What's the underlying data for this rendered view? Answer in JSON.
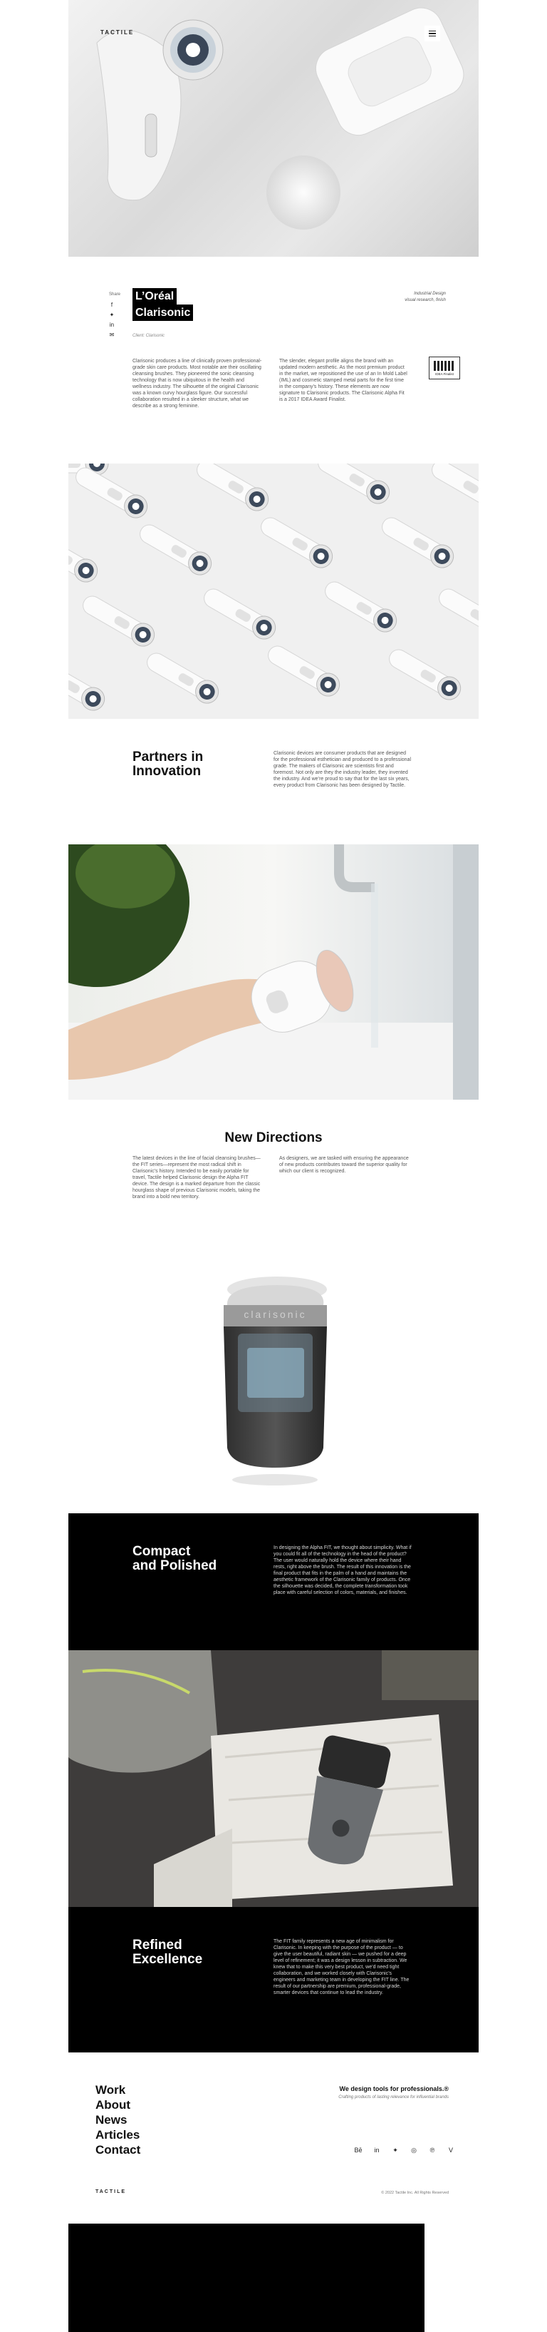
{
  "header": {
    "logo": "TACTILE"
  },
  "intro": {
    "share_label": "Share",
    "title_line1": "L’Oréal",
    "title_line2": "Clarisonic",
    "client_label": "Client: Clarisonic",
    "services": "Industrial Design\nvisual research, finish",
    "para_left": "Clarisonic produces a line of clinically proven professional-grade skin care products. Most notable are their oscillating cleansing brushes. They pioneered the sonic cleansing technology that is now ubiquitous in the health and wellness industry. The silhouette of the original Clarisonic was a known curvy hourglass figure. Our successful collaboration resulted in a sleeker structure, what we describe as a strong feminine.",
    "para_right": "The slender, elegant profile aligns the brand with an updated modern aesthetic. As the most premium product in the market, we repositioned the use of an In Mold Label (IML) and cosmetic stamped metal parts for the first time in the company’s history. These elements are now signature to Clarisonic products. The Clarisonic Alpha Fit is a 2017 IDEA Award Finalist.",
    "award_label": "IDEA Finalist"
  },
  "partners": {
    "heading_line1": "Partners in",
    "heading_line2": "Innovation",
    "para": "Clarisonic devices are consumer products that are designed for the professional esthetician and produced to a professional grade. The makers of Clarisonic are scientists first and foremost. Not only are they the industry leader, they invented the industry. And we’re proud to say that for the last six years, every product from Clarisonic has been designed by Tactile."
  },
  "new_directions": {
    "heading": "New Directions",
    "para_left": "The latest devices in the line of facial cleansing brushes—the FIT series—represent the most radical shift in Clarisonic’s history. Intended to be easily portable for travel, Tactile helped Clarisonic design the Alpha FIT device. The design is a marked departure from the classic hourglass shape of previous Clarisonic models, taking the brand into a bold new territory.",
    "para_right": "As designers, we are tasked with ensuring the appearance of new products contributes toward the superior quality for which our client is recognized.",
    "device_brand": "clarisonic"
  },
  "compact": {
    "heading_line1": "Compact",
    "heading_line2": "and Polished",
    "para": "In designing the Alpha FIT, we thought about simplicity. What if you could fit all of the technology in the head of the product? The user would naturally hold the device where their hand rests, right above the brush. The result of this innovation is the final product that fits in the palm of a hand and maintains the aesthetic framework of the Clarisonic family of products. Once the silhouette was decided, the complete transformation took place with careful selection of colors, materials, and finishes."
  },
  "refined": {
    "heading_line1": "Refined",
    "heading_line2": "Excellence",
    "para": "The FIT family represents a new age of minimalism for Clarisonic. In keeping with the purpose of the product — to give the user beautiful, radiant skin — we pushed for a deep level of refinement; it was a design lesson in subtraction. We knew that to make this very best product, we’d need tight collaboration, and we worked closely with Clarisonic’s engineers and marketing team in developing the FIT line. The result of our partnership are premium, professional-grade, smarter devices that continue to lead the industry."
  },
  "footer": {
    "nav": [
      "Work",
      "About",
      "News",
      "Articles",
      "Contact"
    ],
    "tagline": "We design tools for professionals.®",
    "sub_tagline": "Crafting products of lasting relevance for influential brands",
    "logo": "TACTILE",
    "copyright": "© 2022 Tactile Inc. All Rights Reserved"
  },
  "colors": {
    "black": "#000000",
    "white": "#ffffff",
    "accent_text": "#111111"
  },
  "icons": {
    "share": [
      "facebook-icon",
      "twitter-icon",
      "linkedin-icon",
      "email-icon"
    ],
    "footer": [
      "behance-icon",
      "linkedin-icon",
      "twitter-icon",
      "instagram-icon",
      "pinterest-icon",
      "vimeo-icon"
    ]
  }
}
